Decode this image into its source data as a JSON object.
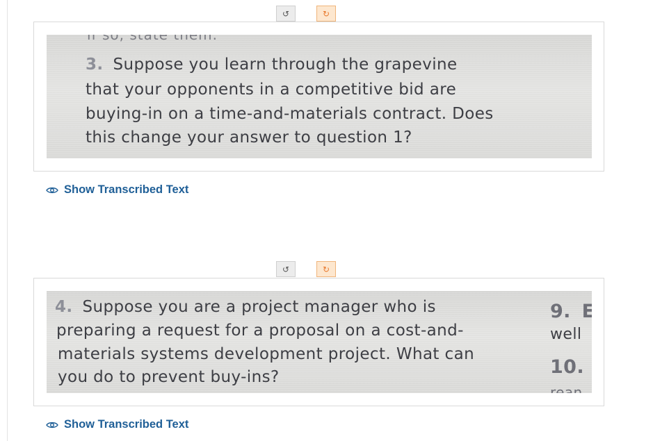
{
  "controls": {
    "rotate_left_icon": "↺",
    "rotate_right_icon": "↻"
  },
  "question3": {
    "cut_text": "if so, state them.",
    "number": "3.",
    "lines": [
      "Suppose you learn through the grapevine",
      "that your opponents in a competitive bid are",
      "buying-in on a time-and-materials contract. Does",
      "this change your answer to question 1?"
    ],
    "link_label": "Show Transcribed Text"
  },
  "question4": {
    "number": "4.",
    "lines": [
      "Suppose you are a project manager who is",
      "preparing a request for a proposal on a cost-and-",
      "materials systems development project. What can",
      "you do to prevent buy-ins?"
    ],
    "side_number_9": "9.",
    "side_letter": "E",
    "side_word": "well",
    "side_number_10": "10.",
    "side_cut": "rean",
    "link_label": "Show Transcribed Text"
  },
  "icons": {
    "rotate": "rotate-arrow-icon",
    "eye": "eye-icon"
  },
  "colors": {
    "link": "#1f5f97",
    "accent_button": "#e8792d",
    "photo_text": "#3d3e44"
  }
}
